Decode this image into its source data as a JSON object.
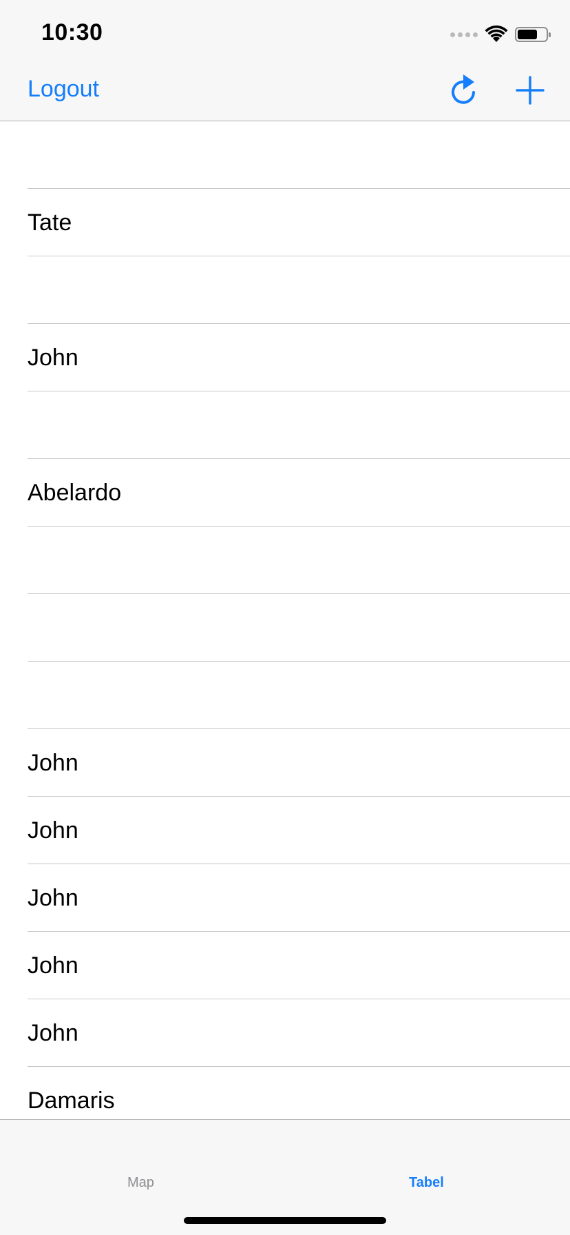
{
  "status_bar": {
    "time": "10:30"
  },
  "nav_bar": {
    "logout_label": "Logout",
    "refresh_icon": "refresh-icon",
    "add_icon": "plus-icon",
    "accent_color": "#157efb"
  },
  "list": {
    "rows": [
      "",
      "Tate",
      "",
      "John",
      "",
      "Abelardo",
      "",
      "",
      "",
      "John",
      "John",
      "John",
      "John",
      "John",
      "Damaris"
    ]
  },
  "tab_bar": {
    "tabs": [
      {
        "label": "Map",
        "selected": false
      },
      {
        "label": "Tabel",
        "selected": true
      }
    ]
  }
}
